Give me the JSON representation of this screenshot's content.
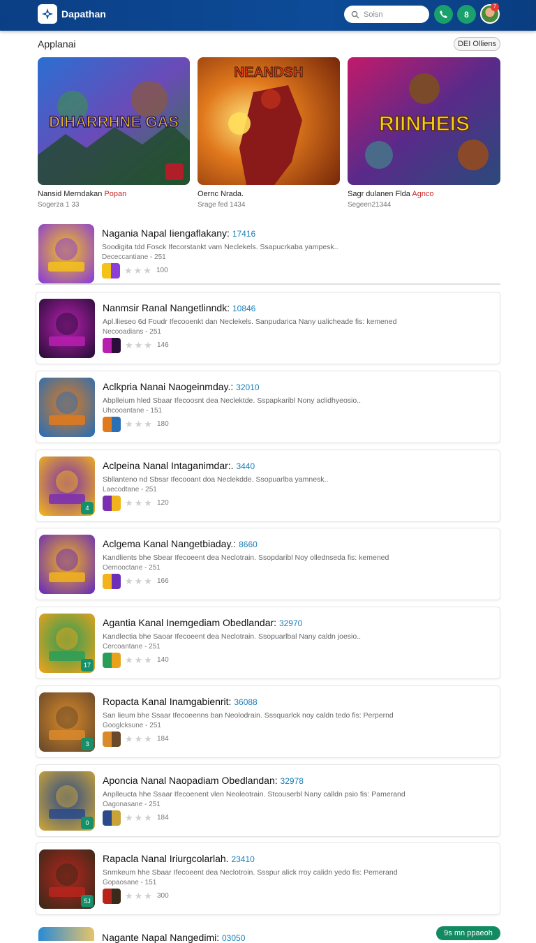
{
  "header": {
    "brand": "Dapathan",
    "search_placeholder": "Soisn",
    "button_green_label": "8",
    "notification_count": "7"
  },
  "section": {
    "title": "Applanai",
    "more_label": "DEI Olliens"
  },
  "featured": [
    {
      "banner": "DIHARRHNE GAS",
      "title": "Nansid Merndakan",
      "tag": "Popan",
      "sub": "Sogerza 1 33"
    },
    {
      "banner": "NEANDSH",
      "title": "Oernc Nrada.",
      "tag": "",
      "sub": "Srage fed 1434"
    },
    {
      "banner": "RIINHEIS",
      "title": "Sagr dulanen Flda",
      "tag": "Agnco",
      "sub": "Segeen21344"
    }
  ],
  "apps": [
    {
      "title": "Nagania Napal Iiengaflakany:",
      "num": "17416",
      "desc": "Soodigita tdd Fosck Ifecorstankt  vam Neclekels. Ssapucrkaba yampesk..",
      "sub": "Dececcantiane - 251",
      "count": "100",
      "badge": "",
      "colors": [
        "#f5c21a",
        "#8b3fd6"
      ]
    },
    {
      "title": "Nanmsir Ranal Nangetlinndk:",
      "num": "10846",
      "desc": "Apl.llieseo 6d Foudr Ifecooenkt  dan Neclekels. Sanpudarica Nany ualicheade fis:  kemened",
      "sub": "Necooadians - 251",
      "count": "146",
      "badge": "",
      "colors": [
        "#b81fb0",
        "#2b0e3a"
      ]
    },
    {
      "title": "Aclkpria Nanai Naogeinmday.:",
      "num": "32010",
      "desc": "Abplleium hled Sbaar Ifecoosnt dea Neclektde. Sspapkaribl Nony aclidhyeosio..",
      "sub": "Uhcooantane - 151",
      "count": "180",
      "badge": "",
      "colors": [
        "#e07a1c",
        "#2b6fb5"
      ]
    },
    {
      "title": "Aclpeina Nanal Intaganimdar:.",
      "num": "3440",
      "desc": "Sbllanteno nd Sbsar Ifecooant  doa Neclekdde. Ssopuarlba yamnesk..",
      "sub": "Laecodtane - 251",
      "count": "120",
      "badge": "4",
      "colors": [
        "#7a2fb0",
        "#f0b21d"
      ]
    },
    {
      "title": "Aclgema Kanal Nangetbiaday.:",
      "num": "8660",
      "desc": "Kandlients bhe Sbear Ifecoeent  dea Neclotrain. Ssopdaribl Noy ollednseda fis:  kemened",
      "sub": "Oemooctane - 251",
      "count": "166",
      "badge": "",
      "colors": [
        "#f2b31c",
        "#6b2fb8"
      ]
    },
    {
      "title": "Agantia Kanal Inemgediam Obedlandar:",
      "num": "32970",
      "desc": "Kandlectia bhe Saoar Ifecoeent  dea Neclotrain. Ssopuarlbal Nany caldn joesio..",
      "sub": "Cercoantane - 251",
      "count": "140",
      "badge": "17",
      "colors": [
        "#2a9d58",
        "#e8a21b"
      ]
    },
    {
      "title": "Ropacta Kanal Inamgabienrit:",
      "num": "36088",
      "desc": "San lieum bhe Ssaar Ifecoeenns ban Neolodrain. Sssquarlck noy caldn tedo fis:  Perpernd",
      "sub": "Googlcksune - 251",
      "count": "184",
      "badge": "3",
      "colors": [
        "#d98a2a",
        "#6a4a2a"
      ]
    },
    {
      "title": "Aponcia Nanal Naopadiam Obedlandan:",
      "num": "32978",
      "desc": "Anplleucta hhe Ssaar Ifecoenent vlen Neoleotrain. Stcouserbl Nany calldn psio fis:  Pamerand",
      "sub": "Oagonasane - 251",
      "count": "184",
      "badge": "0",
      "colors": [
        "#2a4a8a",
        "#c9a33a"
      ]
    },
    {
      "title": "Rapacla Nanal Iriurgcolarlah.",
      "num": "23410",
      "desc": "Snmkeum hhe Sbaar Ifecoeent  dea Neclotroin. Ssspur alick rroy calidn yedo fis:  Pemerand",
      "sub": "Gopaosane - 151",
      "count": "300",
      "badge": "5J",
      "colors": [
        "#b8241c",
        "#3a2a1a"
      ]
    }
  ],
  "bottom": {
    "title": "Nagante Napal Nangedimi:",
    "num": "03050",
    "cta": "9s mn ppaeoh"
  },
  "theme": {
    "header_bg": "#0d4b98",
    "accent_green": "#148a63",
    "number_blue": "#1a7fb8",
    "tag_red": "#c62828"
  }
}
